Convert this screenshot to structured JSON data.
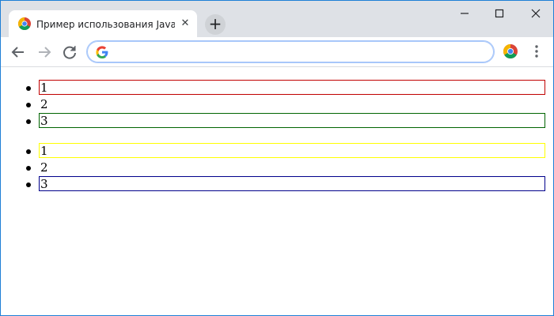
{
  "browser": {
    "tab_title": "Пример использования JavaScript",
    "tab_close": "✕",
    "new_tab": "+",
    "address_value": "",
    "window_controls": {
      "minimize": "–",
      "maximize": "☐",
      "close": "✕"
    }
  },
  "lists": [
    {
      "items": [
        {
          "text": "1",
          "border_color": "#c00000"
        },
        {
          "text": "2",
          "border_color": ""
        },
        {
          "text": "3",
          "border_color": "#006400"
        }
      ]
    },
    {
      "items": [
        {
          "text": "1",
          "border_color": "#ffff00"
        },
        {
          "text": "2",
          "border_color": ""
        },
        {
          "text": "3",
          "border_color": "#00008b"
        }
      ]
    }
  ]
}
